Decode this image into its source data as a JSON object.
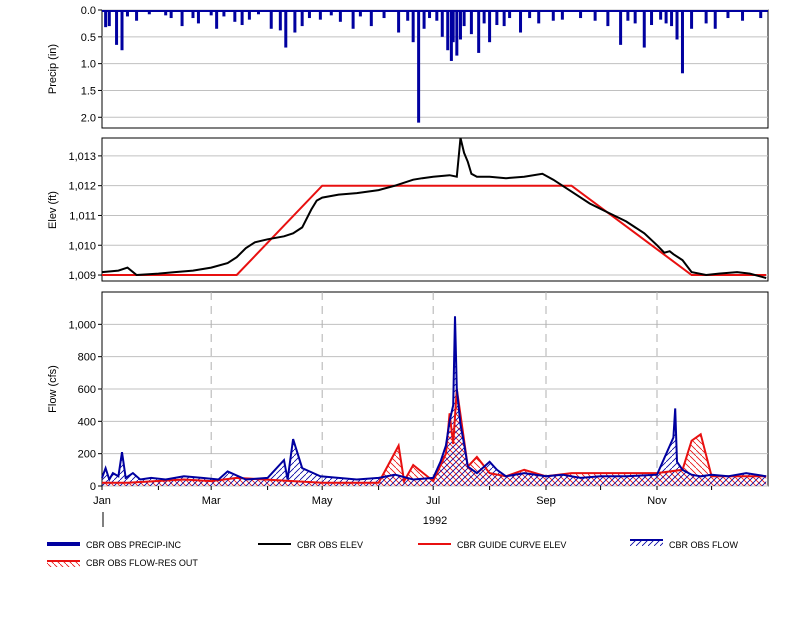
{
  "colors": {
    "precip": "#0000a0",
    "elev": "#000000",
    "guide": "#e81010",
    "flow": "#0000a0",
    "resout": "#e81010",
    "grid": "#c0c0c0",
    "dashed": "#b0b0b0"
  },
  "x_axis": {
    "year_label": "1992",
    "month_labels": [
      "Jan",
      "Mar",
      "May",
      "Jul",
      "Sep",
      "Nov"
    ]
  },
  "chart_data": [
    {
      "type": "bar",
      "name": "precip-panel",
      "ylabel": "Precip (in)",
      "ylim": [
        0,
        2.2
      ],
      "y_inverted": true,
      "yticks": [
        "0.0",
        "0.5",
        "1.0",
        "1.5",
        "2.0"
      ],
      "series": [
        {
          "name": "CBR OBS PRECIP-INC",
          "x": [
            "1992-01-03",
            "1992-01-05",
            "1992-01-09",
            "1992-01-12",
            "1992-01-15",
            "1992-01-20",
            "1992-01-27",
            "1992-02-05",
            "1992-02-08",
            "1992-02-14",
            "1992-02-20",
            "1992-02-23",
            "1992-03-01",
            "1992-03-04",
            "1992-03-08",
            "1992-03-14",
            "1992-03-18",
            "1992-03-22",
            "1992-03-27",
            "1992-04-03",
            "1992-04-08",
            "1992-04-11",
            "1992-04-16",
            "1992-04-20",
            "1992-04-24",
            "1992-04-30",
            "1992-05-06",
            "1992-05-11",
            "1992-05-18",
            "1992-05-22",
            "1992-05-28",
            "1992-06-04",
            "1992-06-12",
            "1992-06-17",
            "1992-06-20",
            "1992-06-23",
            "1992-06-26",
            "1992-06-29",
            "1992-07-03",
            "1992-07-06",
            "1992-07-09",
            "1992-07-11",
            "1992-07-12",
            "1992-07-14",
            "1992-07-16",
            "1992-07-18",
            "1992-07-22",
            "1992-07-26",
            "1992-07-29",
            "1992-08-01",
            "1992-08-05",
            "1992-08-09",
            "1992-08-12",
            "1992-08-18",
            "1992-08-23",
            "1992-08-28",
            "1992-09-05",
            "1992-09-10",
            "1992-09-20",
            "1992-09-28",
            "1992-10-05",
            "1992-10-12",
            "1992-10-16",
            "1992-10-20",
            "1992-10-25",
            "1992-10-29",
            "1992-11-03",
            "1992-11-06",
            "1992-11-09",
            "1992-11-12",
            "1992-11-15",
            "1992-11-20",
            "1992-11-28",
            "1992-12-03",
            "1992-12-10",
            "1992-12-18",
            "1992-12-28"
          ],
          "values": [
            0.32,
            0.3,
            0.65,
            0.75,
            0.12,
            0.2,
            0.08,
            0.1,
            0.15,
            0.3,
            0.15,
            0.25,
            0.1,
            0.35,
            0.12,
            0.22,
            0.28,
            0.18,
            0.08,
            0.35,
            0.38,
            0.7,
            0.42,
            0.3,
            0.15,
            0.18,
            0.1,
            0.22,
            0.35,
            0.12,
            0.3,
            0.15,
            0.42,
            0.2,
            0.6,
            2.1,
            0.35,
            0.15,
            0.2,
            0.5,
            0.75,
            0.95,
            0.6,
            0.85,
            0.55,
            0.3,
            0.45,
            0.8,
            0.25,
            0.6,
            0.28,
            0.3,
            0.15,
            0.42,
            0.15,
            0.25,
            0.2,
            0.18,
            0.15,
            0.2,
            0.3,
            0.65,
            0.2,
            0.25,
            0.7,
            0.28,
            0.18,
            0.25,
            0.3,
            0.55,
            1.18,
            0.35,
            0.25,
            0.35,
            0.15,
            0.2,
            0.15
          ]
        }
      ]
    },
    {
      "type": "line",
      "name": "elev-panel",
      "ylabel": "Elev (ft)",
      "ylim": [
        1008.8,
        1013.6
      ],
      "yticks": [
        "1,009",
        "1,010",
        "1,011",
        "1,012",
        "1,013"
      ],
      "series": [
        {
          "name": "CBR OBS ELEV",
          "x": [
            "1992-01-01",
            "1992-01-10",
            "1992-01-15",
            "1992-01-20",
            "1992-02-01",
            "1992-02-10",
            "1992-02-20",
            "1992-03-01",
            "1992-03-10",
            "1992-03-15",
            "1992-03-20",
            "1992-03-25",
            "1992-04-01",
            "1992-04-10",
            "1992-04-15",
            "1992-04-20",
            "1992-04-25",
            "1992-04-28",
            "1992-05-01",
            "1992-05-10",
            "1992-05-20",
            "1992-06-01",
            "1992-06-10",
            "1992-06-20",
            "1992-06-25",
            "1992-07-01",
            "1992-07-10",
            "1992-07-14",
            "1992-07-16",
            "1992-07-18",
            "1992-07-20",
            "1992-07-22",
            "1992-07-25",
            "1992-08-01",
            "1992-08-10",
            "1992-08-20",
            "1992-08-30",
            "1992-09-05",
            "1992-09-15",
            "1992-09-25",
            "1992-10-05",
            "1992-10-15",
            "1992-10-25",
            "1992-11-01",
            "1992-11-05",
            "1992-11-08",
            "1992-11-10",
            "1992-11-15",
            "1992-11-20",
            "1992-11-28",
            "1992-12-05",
            "1992-12-15",
            "1992-12-22",
            "1992-12-31"
          ],
          "values": [
            1009.1,
            1009.15,
            1009.25,
            1009.0,
            1009.05,
            1009.1,
            1009.15,
            1009.25,
            1009.4,
            1009.6,
            1009.9,
            1010.1,
            1010.2,
            1010.3,
            1010.4,
            1010.6,
            1011.2,
            1011.5,
            1011.6,
            1011.7,
            1011.75,
            1011.85,
            1012.0,
            1012.2,
            1012.25,
            1012.3,
            1012.35,
            1012.3,
            1013.6,
            1013.1,
            1012.8,
            1012.4,
            1012.3,
            1012.3,
            1012.25,
            1012.3,
            1012.4,
            1012.2,
            1011.8,
            1011.4,
            1011.1,
            1010.8,
            1010.4,
            1010.0,
            1009.75,
            1009.8,
            1009.7,
            1009.5,
            1009.1,
            1009.0,
            1009.05,
            1009.1,
            1009.05,
            1008.9
          ]
        },
        {
          "name": "CBR GUIDE CURVE ELEV",
          "x": [
            "1992-01-01",
            "1992-03-15",
            "1992-05-01",
            "1992-09-15",
            "1992-11-20",
            "1992-12-31"
          ],
          "values": [
            1009,
            1009,
            1012,
            1012,
            1009,
            1009
          ]
        }
      ]
    },
    {
      "type": "area",
      "name": "flow-panel",
      "ylabel": "Flow (cfs)",
      "ylim": [
        0,
        1200
      ],
      "yticks": [
        "0",
        "200",
        "400",
        "600",
        "800",
        "1,000"
      ],
      "series": [
        {
          "name": "CBR OBS FLOW",
          "x": [
            "1992-01-01",
            "1992-01-03",
            "1992-01-05",
            "1992-01-07",
            "1992-01-10",
            "1992-01-12",
            "1992-01-14",
            "1992-01-18",
            "1992-01-22",
            "1992-01-28",
            "1992-02-05",
            "1992-02-15",
            "1992-02-25",
            "1992-03-05",
            "1992-03-10",
            "1992-03-20",
            "1992-04-01",
            "1992-04-10",
            "1992-04-12",
            "1992-04-15",
            "1992-04-20",
            "1992-04-30",
            "1992-05-10",
            "1992-05-20",
            "1992-06-01",
            "1992-06-10",
            "1992-06-20",
            "1992-07-01",
            "1992-07-05",
            "1992-07-08",
            "1992-07-10",
            "1992-07-12",
            "1992-07-13",
            "1992-07-14",
            "1992-07-16",
            "1992-07-18",
            "1992-07-20",
            "1992-07-25",
            "1992-08-01",
            "1992-08-05",
            "1992-08-10",
            "1992-08-20",
            "1992-09-01",
            "1992-09-10",
            "1992-09-20",
            "1992-10-01",
            "1992-10-15",
            "1992-11-01",
            "1992-11-10",
            "1992-11-11",
            "1992-11-12",
            "1992-11-15",
            "1992-11-20",
            "1992-11-25",
            "1992-12-01",
            "1992-12-10",
            "1992-12-20",
            "1992-12-31"
          ],
          "values": [
            50,
            110,
            40,
            80,
            60,
            210,
            50,
            80,
            40,
            50,
            40,
            60,
            50,
            40,
            90,
            40,
            50,
            160,
            40,
            290,
            110,
            60,
            50,
            40,
            50,
            70,
            40,
            50,
            150,
            250,
            400,
            500,
            1050,
            600,
            380,
            260,
            120,
            80,
            150,
            100,
            60,
            80,
            60,
            70,
            50,
            60,
            60,
            70,
            300,
            480,
            150,
            100,
            70,
            60,
            70,
            60,
            80,
            60
          ]
        },
        {
          "name": "CBR OBS FLOW-RES OUT",
          "x": [
            "1992-01-01",
            "1992-01-15",
            "1992-02-15",
            "1992-03-01",
            "1992-03-15",
            "1992-04-15",
            "1992-05-01",
            "1992-06-01",
            "1992-06-12",
            "1992-06-15",
            "1992-06-20",
            "1992-07-01",
            "1992-07-08",
            "1992-07-10",
            "1992-07-12",
            "1992-07-14",
            "1992-07-16",
            "1992-07-20",
            "1992-07-25",
            "1992-08-01",
            "1992-08-10",
            "1992-08-20",
            "1992-09-01",
            "1992-09-15",
            "1992-10-01",
            "1992-10-15",
            "1992-11-01",
            "1992-11-15",
            "1992-11-20",
            "1992-11-25",
            "1992-12-01",
            "1992-12-15",
            "1992-12-31"
          ],
          "values": [
            20,
            20,
            40,
            30,
            50,
            30,
            20,
            20,
            250,
            30,
            130,
            30,
            200,
            450,
            260,
            600,
            440,
            120,
            180,
            80,
            60,
            100,
            60,
            80,
            80,
            80,
            80,
            100,
            280,
            320,
            60,
            60,
            60
          ]
        }
      ]
    }
  ],
  "legend": [
    {
      "name": "CBR OBS PRECIP-INC"
    },
    {
      "name": "CBR OBS ELEV"
    },
    {
      "name": "CBR GUIDE CURVE ELEV"
    },
    {
      "name": "CBR OBS FLOW"
    },
    {
      "name": "CBR OBS FLOW-RES OUT"
    }
  ]
}
